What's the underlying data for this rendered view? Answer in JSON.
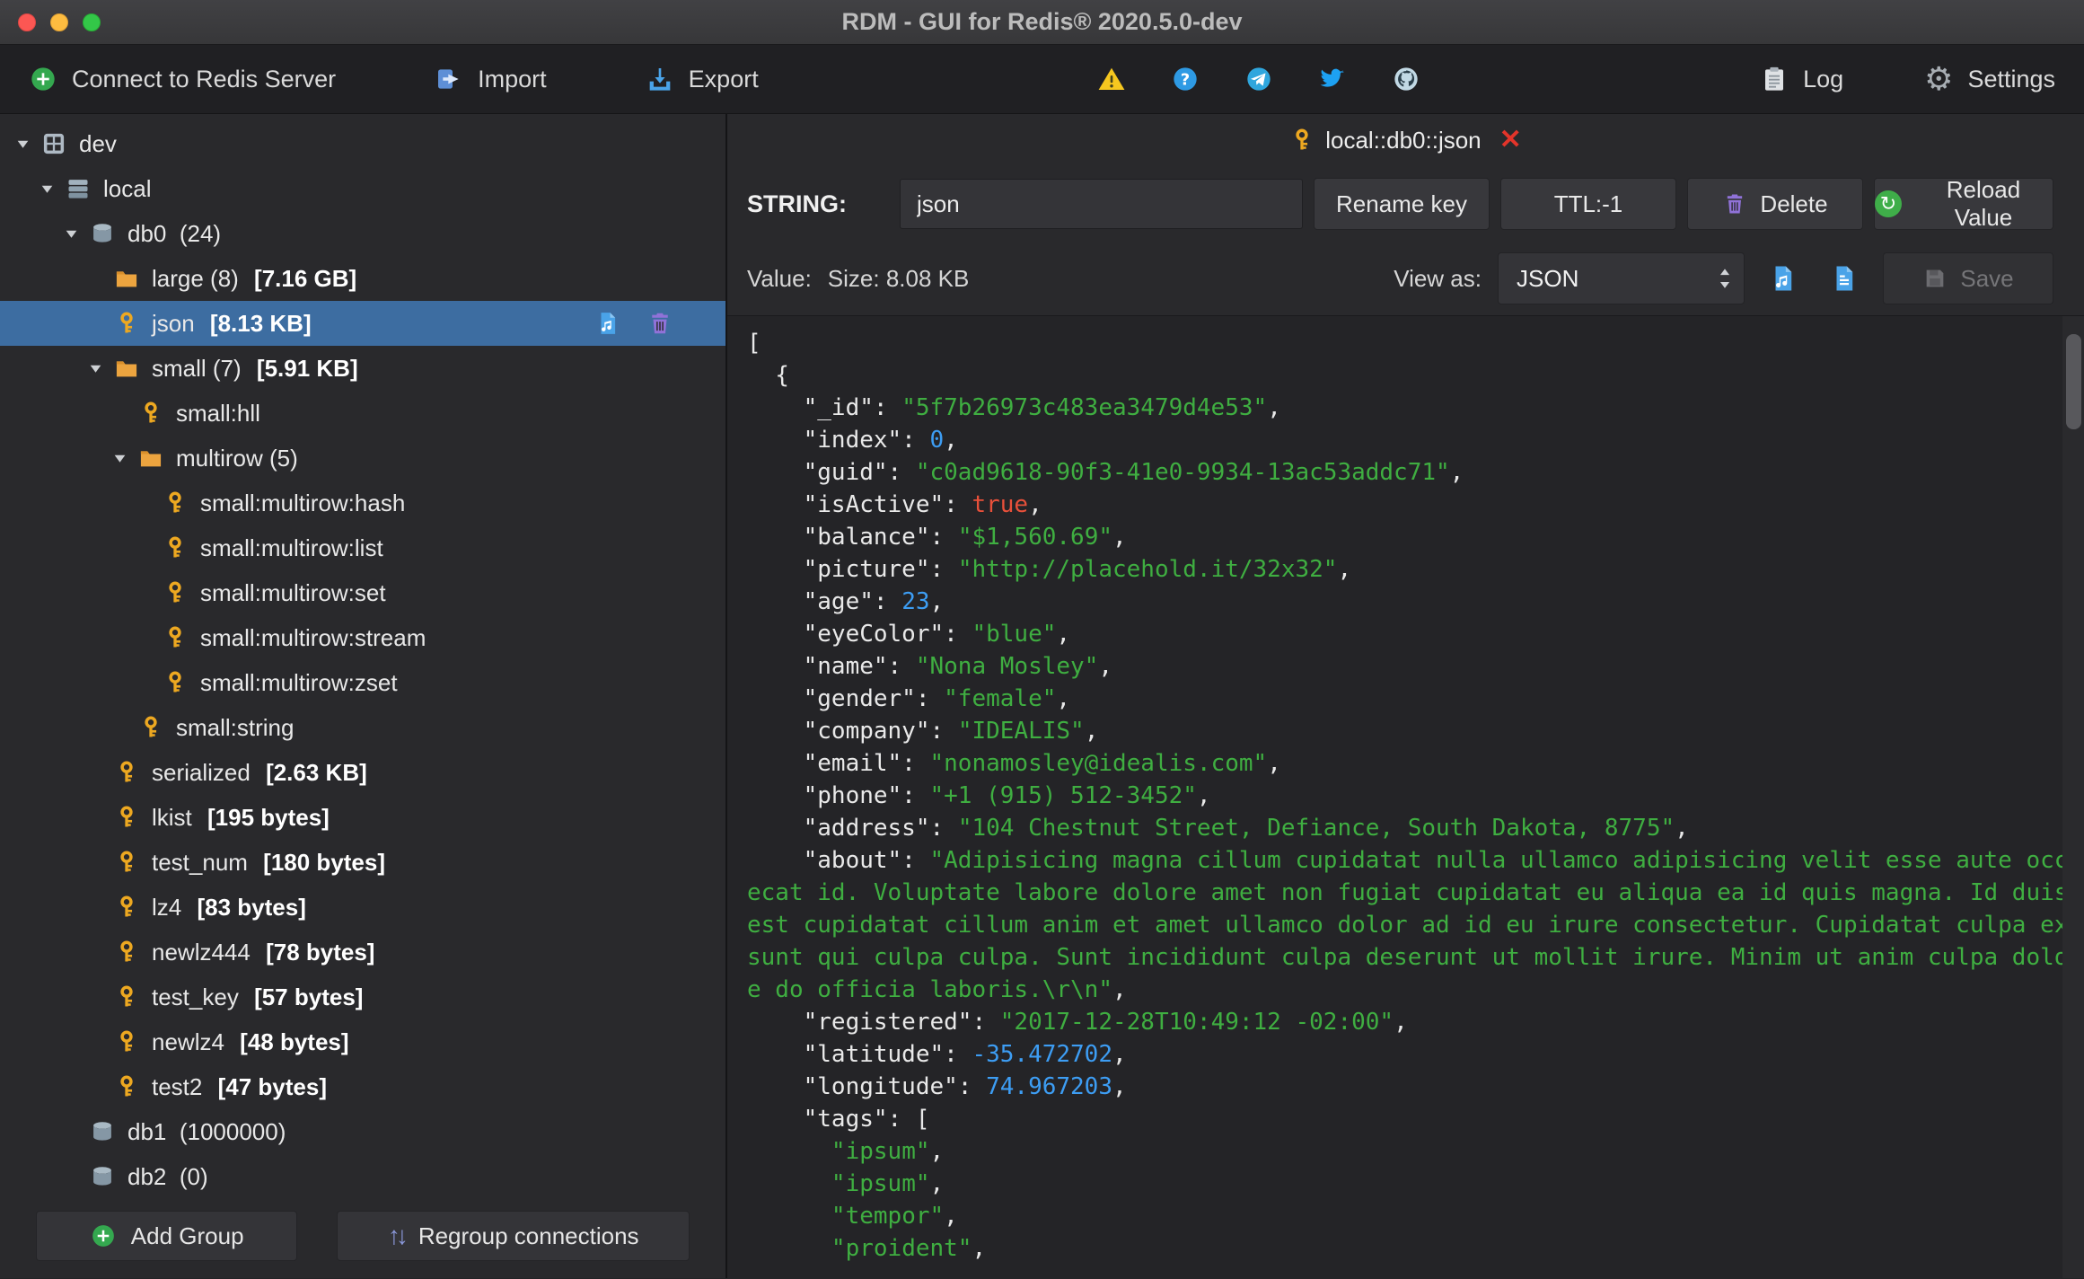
{
  "window": {
    "title": "RDM - GUI for Redis® 2020.5.0-dev"
  },
  "toolbar": {
    "connect_label": "Connect to Redis Server",
    "import_label": "Import",
    "export_label": "Export",
    "log_label": "Log",
    "settings_label": "Settings"
  },
  "sidebar": {
    "add_group_label": "Add Group",
    "regroup_label": "Regroup connections",
    "tree": [
      {
        "level": 0,
        "icon": "connection",
        "arrow": true,
        "label": "dev"
      },
      {
        "level": 1,
        "icon": "server",
        "arrow": true,
        "label": "local"
      },
      {
        "level": 2,
        "icon": "db",
        "arrow": true,
        "label": "db0  (24)"
      },
      {
        "level": 3,
        "icon": "folder",
        "arrow": false,
        "label": "large (8) ",
        "size": "[7.16 GB]"
      },
      {
        "level": 3,
        "icon": "key",
        "arrow": false,
        "label": "json ",
        "size": "[8.13 KB]",
        "selected": true
      },
      {
        "level": 3,
        "icon": "folder",
        "arrow": true,
        "label": "small (7) ",
        "size": "[5.91 KB]"
      },
      {
        "level": 4,
        "icon": "key",
        "arrow": false,
        "label": "small:hll"
      },
      {
        "level": 4,
        "icon": "folder",
        "arrow": true,
        "label": "multirow (5)"
      },
      {
        "level": 5,
        "icon": "key",
        "arrow": false,
        "label": "small:multirow:hash"
      },
      {
        "level": 5,
        "icon": "key",
        "arrow": false,
        "label": "small:multirow:list"
      },
      {
        "level": 5,
        "icon": "key",
        "arrow": false,
        "label": "small:multirow:set"
      },
      {
        "level": 5,
        "icon": "key",
        "arrow": false,
        "label": "small:multirow:stream"
      },
      {
        "level": 5,
        "icon": "key",
        "arrow": false,
        "label": "small:multirow:zset"
      },
      {
        "level": 4,
        "icon": "key",
        "arrow": false,
        "label": "small:string"
      },
      {
        "level": 3,
        "icon": "key",
        "arrow": false,
        "label": "serialized ",
        "size": "[2.63 KB]"
      },
      {
        "level": 3,
        "icon": "key",
        "arrow": false,
        "label": "lkist ",
        "size": "[195 bytes]"
      },
      {
        "level": 3,
        "icon": "key",
        "arrow": false,
        "label": "test_num ",
        "size": "[180 bytes]"
      },
      {
        "level": 3,
        "icon": "key",
        "arrow": false,
        "label": "lz4 ",
        "size": "[83 bytes]"
      },
      {
        "level": 3,
        "icon": "key",
        "arrow": false,
        "label": "newlz444 ",
        "size": "[78 bytes]"
      },
      {
        "level": 3,
        "icon": "key",
        "arrow": false,
        "label": "test_key ",
        "size": "[57 bytes]"
      },
      {
        "level": 3,
        "icon": "key",
        "arrow": false,
        "label": "newlz4 ",
        "size": "[48 bytes]"
      },
      {
        "level": 3,
        "icon": "key",
        "arrow": false,
        "label": "test2 ",
        "size": "[47 bytes]"
      },
      {
        "level": 2,
        "icon": "db",
        "arrow": false,
        "label": "db1  (1000000)"
      },
      {
        "level": 2,
        "icon": "db",
        "arrow": false,
        "label": "db2  (0)"
      }
    ]
  },
  "main": {
    "tab_label": "local::db0::json",
    "key_row": {
      "type_label": "STRING:",
      "key_name": "json",
      "rename_label": "Rename key",
      "ttl_label": "TTL:-1",
      "delete_label": "Delete",
      "reload_label": "Reload Value"
    },
    "value_row": {
      "value_label": "Value:",
      "size_label": "Size: 8.08 KB",
      "view_as_label": "View as:",
      "format_value": "JSON",
      "save_label": "Save"
    }
  },
  "editor": {
    "lines": [
      [
        [
          "t",
          "["
        ]
      ],
      [
        [
          "t",
          "  {"
        ]
      ],
      [
        [
          "t",
          "    \"_id\": "
        ],
        [
          "s",
          "\"5f7b26973c483ea3479d4e53\""
        ],
        [
          "t",
          ","
        ]
      ],
      [
        [
          "t",
          "    \"index\": "
        ],
        [
          "n",
          "0"
        ],
        [
          "t",
          ","
        ]
      ],
      [
        [
          "t",
          "    \"guid\": "
        ],
        [
          "s",
          "\"c0ad9618-90f3-41e0-9934-13ac53addc71\""
        ],
        [
          "t",
          ","
        ]
      ],
      [
        [
          "t",
          "    \"isActive\": "
        ],
        [
          "b",
          "true"
        ],
        [
          "t",
          ","
        ]
      ],
      [
        [
          "t",
          "    \"balance\": "
        ],
        [
          "s",
          "\"$1,560.69\""
        ],
        [
          "t",
          ","
        ]
      ],
      [
        [
          "t",
          "    \"picture\": "
        ],
        [
          "s",
          "\"http://placehold.it/32x32\""
        ],
        [
          "t",
          ","
        ]
      ],
      [
        [
          "t",
          "    \"age\": "
        ],
        [
          "n",
          "23"
        ],
        [
          "t",
          ","
        ]
      ],
      [
        [
          "t",
          "    \"eyeColor\": "
        ],
        [
          "s",
          "\"blue\""
        ],
        [
          "t",
          ","
        ]
      ],
      [
        [
          "t",
          "    \"name\": "
        ],
        [
          "s",
          "\"Nona Mosley\""
        ],
        [
          "t",
          ","
        ]
      ],
      [
        [
          "t",
          "    \"gender\": "
        ],
        [
          "s",
          "\"female\""
        ],
        [
          "t",
          ","
        ]
      ],
      [
        [
          "t",
          "    \"company\": "
        ],
        [
          "s",
          "\"IDEALIS\""
        ],
        [
          "t",
          ","
        ]
      ],
      [
        [
          "t",
          "    \"email\": "
        ],
        [
          "s",
          "\"nonamosley@idealis.com\""
        ],
        [
          "t",
          ","
        ]
      ],
      [
        [
          "t",
          "    \"phone\": "
        ],
        [
          "s",
          "\"+1 (915) 512-3452\""
        ],
        [
          "t",
          ","
        ]
      ],
      [
        [
          "t",
          "    \"address\": "
        ],
        [
          "s",
          "\"104 Chestnut Street, Defiance, South Dakota, 8775\""
        ],
        [
          "t",
          ","
        ]
      ],
      [
        [
          "t",
          "    \"about\": "
        ],
        [
          "s",
          "\"Adipisicing magna cillum cupidatat nulla ullamco adipisicing velit esse aute occa"
        ]
      ],
      [
        [
          "s",
          "ecat id. Voluptate labore dolore amet non fugiat cupidatat eu aliqua ea id quis magna. Id duis "
        ]
      ],
      [
        [
          "s",
          "est cupidatat cillum anim et amet ullamco dolor ad id eu irure consectetur. Cupidatat culpa ex "
        ]
      ],
      [
        [
          "s",
          "sunt qui culpa culpa. Sunt incididunt culpa deserunt ut mollit irure. Minim ut anim culpa dolor"
        ]
      ],
      [
        [
          "s",
          "e do officia laboris.\\r\\n\""
        ],
        [
          "t",
          ","
        ]
      ],
      [
        [
          "t",
          "    \"registered\": "
        ],
        [
          "s",
          "\"2017-12-28T10:49:12 -02:00\""
        ],
        [
          "t",
          ","
        ]
      ],
      [
        [
          "t",
          "    \"latitude\": "
        ],
        [
          "n",
          "-35.472702"
        ],
        [
          "t",
          ","
        ]
      ],
      [
        [
          "t",
          "    \"longitude\": "
        ],
        [
          "n",
          "74.967203"
        ],
        [
          "t",
          ","
        ]
      ],
      [
        [
          "t",
          "    \"tags\": ["
        ]
      ],
      [
        [
          "t",
          "      "
        ],
        [
          "s",
          "\"ipsum\""
        ],
        [
          "t",
          ","
        ]
      ],
      [
        [
          "t",
          "      "
        ],
        [
          "s",
          "\"ipsum\""
        ],
        [
          "t",
          ","
        ]
      ],
      [
        [
          "t",
          "      "
        ],
        [
          "s",
          "\"tempor\""
        ],
        [
          "t",
          ","
        ]
      ],
      [
        [
          "t",
          "      "
        ],
        [
          "s",
          "\"proident\""
        ],
        [
          "t",
          ","
        ]
      ]
    ]
  },
  "colors": {
    "accent_blue": "#3d6da1",
    "string_green": "#3fae41",
    "number_blue": "#3d9df3",
    "bool_red": "#e8503a",
    "key_gold": "#eda821"
  }
}
